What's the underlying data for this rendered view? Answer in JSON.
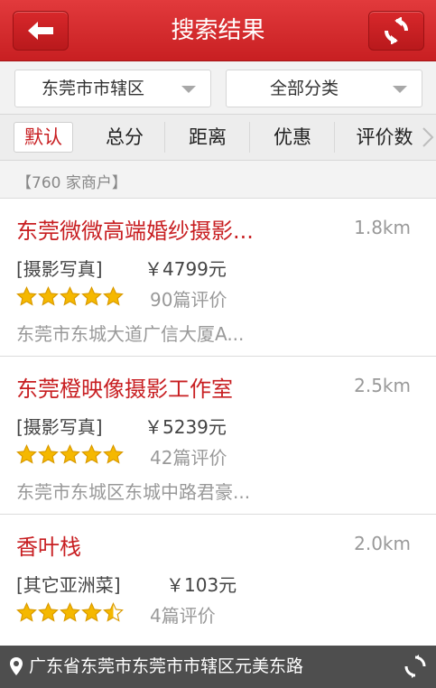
{
  "header": {
    "title": "搜索结果",
    "back_icon": "arrow-left-icon",
    "refresh_icon": "refresh-icon"
  },
  "filters": {
    "area": "东莞市市辖区",
    "category": "全部分类"
  },
  "sort_tabs": [
    "默认",
    "总分",
    "距离",
    "优惠",
    "评价数"
  ],
  "result_count": "【760 家商户】",
  "colors": {
    "brand": "#c81f22",
    "footer": "#4e4e4e",
    "star": "#f5b800"
  },
  "items": [
    {
      "name": "东莞微微高端婚纱摄影...",
      "distance": "1.8km",
      "category": "[摄影写真]",
      "price": "￥4799元",
      "rating": 5,
      "reviews": "90篇评价",
      "address": "东莞市东城大道广信大厦A..."
    },
    {
      "name": "东莞橙映像摄影工作室",
      "distance": "2.5km",
      "category": "[摄影写真]",
      "price": "￥5239元",
      "rating": 5,
      "reviews": "42篇评价",
      "address": "东莞市东城区东城中路君豪..."
    },
    {
      "name": "香叶栈",
      "distance": "2.0km",
      "category": "[其它亚洲菜]",
      "price": "￥103元",
      "rating": 4.5,
      "reviews": "4篇评价",
      "address": ""
    }
  ],
  "footer": {
    "location": "广东省东莞市东莞市市辖区元美东路"
  }
}
